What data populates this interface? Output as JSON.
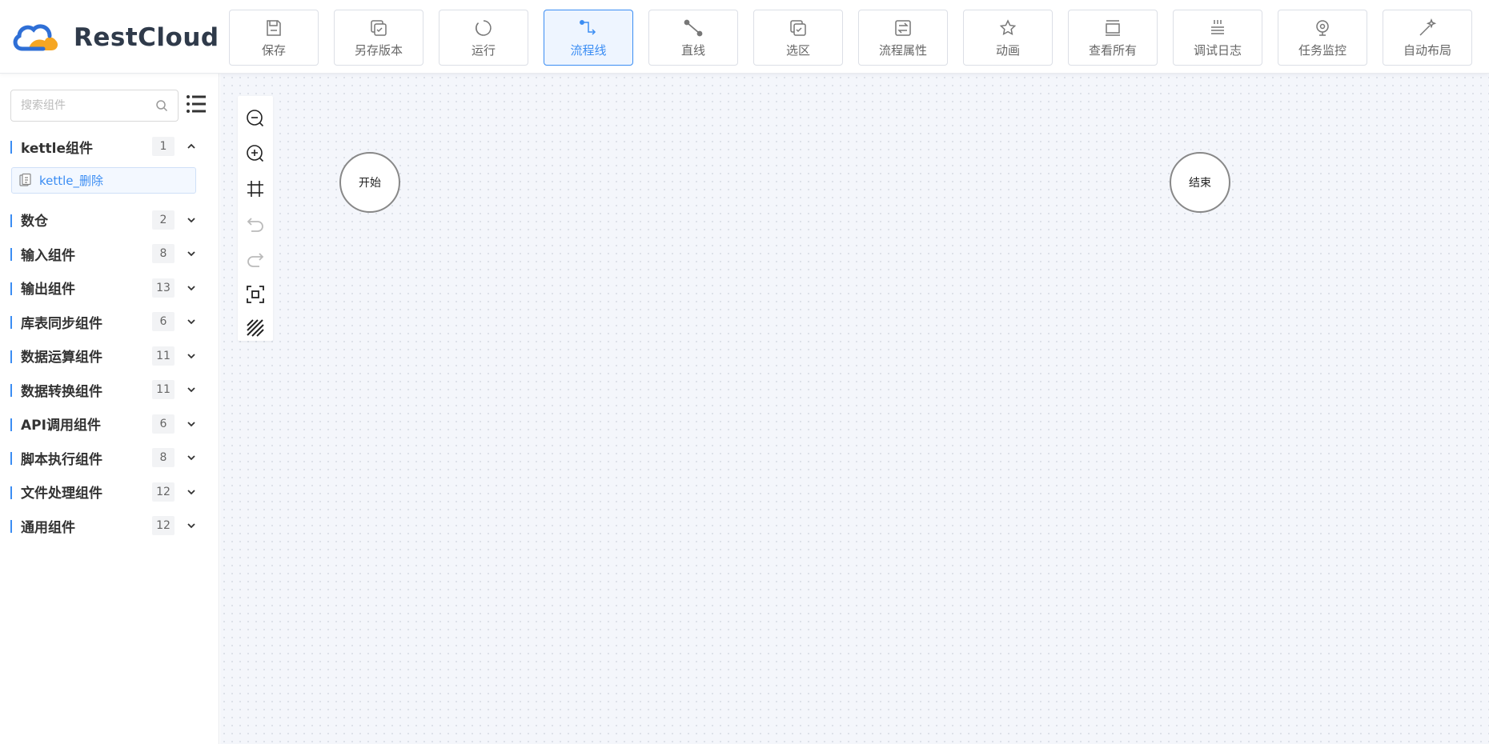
{
  "app": {
    "logo_text": "RestCloud"
  },
  "toolbar": {
    "buttons": [
      {
        "label": "保存",
        "icon": "save-icon"
      },
      {
        "label": "另存版本",
        "icon": "save-version-icon"
      },
      {
        "label": "运行",
        "icon": "run-icon"
      },
      {
        "label": "流程线",
        "icon": "flow-line-icon",
        "active": true
      },
      {
        "label": "直线",
        "icon": "straight-line-icon"
      },
      {
        "label": "选区",
        "icon": "selection-icon"
      },
      {
        "label": "流程属性",
        "icon": "flow-properties-icon"
      },
      {
        "label": "动画",
        "icon": "animation-icon"
      },
      {
        "label": "查看所有",
        "icon": "view-all-icon"
      },
      {
        "label": "调试日志",
        "icon": "debug-log-icon"
      },
      {
        "label": "任务监控",
        "icon": "task-monitor-icon"
      },
      {
        "label": "自动布局",
        "icon": "auto-layout-icon"
      }
    ]
  },
  "sidebar": {
    "search_placeholder": "搜索组件",
    "groups": [
      {
        "name": "kettle组件",
        "count": "1",
        "expanded": true,
        "items": [
          "kettle_删除"
        ]
      },
      {
        "name": "数仓",
        "count": "2"
      },
      {
        "name": "输入组件",
        "count": "8"
      },
      {
        "name": "输出组件",
        "count": "13"
      },
      {
        "name": "库表同步组件",
        "count": "6"
      },
      {
        "name": "数据运算组件",
        "count": "11"
      },
      {
        "name": "数据转换组件",
        "count": "11"
      },
      {
        "name": "API调用组件",
        "count": "6"
      },
      {
        "name": "脚本执行组件",
        "count": "8"
      },
      {
        "name": "文件处理组件",
        "count": "12"
      },
      {
        "name": "通用组件",
        "count": "12"
      }
    ]
  },
  "canvas": {
    "nodes": [
      {
        "label": "开始"
      },
      {
        "label": "结束"
      }
    ]
  },
  "colors": {
    "accent": "#3b8df3",
    "canvas_bg": "#f4f6fb"
  }
}
